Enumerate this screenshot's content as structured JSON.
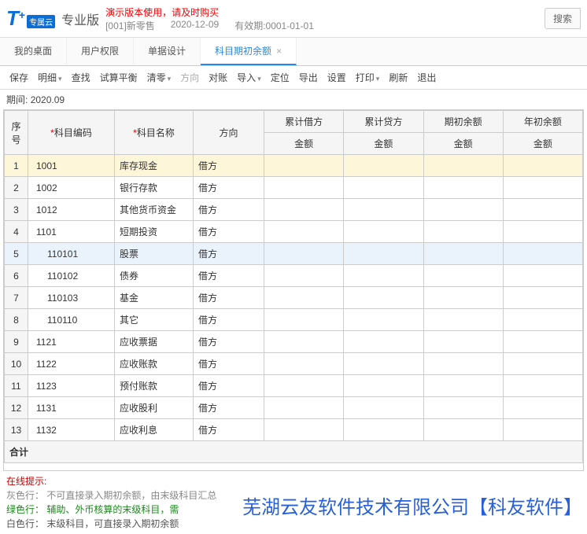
{
  "header": {
    "logo_t": "T",
    "logo_plus": "+",
    "logo_sub": "专属云",
    "edition": "专业版",
    "demo_notice": "演示版本使用，请及时购买",
    "org": "[001]新零售",
    "date": "2020-12-09",
    "expiry_label": "有效期:0001-01-01",
    "search": "搜索"
  },
  "tabs": [
    {
      "label": "我的桌面"
    },
    {
      "label": "用户权限"
    },
    {
      "label": "单据设计"
    },
    {
      "label": "科目期初余额",
      "active": true
    }
  ],
  "toolbar": {
    "save": "保存",
    "detail": "明细",
    "search": "查找",
    "balance": "试算平衡",
    "clear": "清零",
    "direction": "方向",
    "reconcile": "对账",
    "import": "导入",
    "locate": "定位",
    "export": "导出",
    "settings": "设置",
    "print": "打印",
    "refresh": "刷新",
    "exit": "退出"
  },
  "period": {
    "label": "期间:",
    "value": "2020.09"
  },
  "columns": {
    "idx": "序号",
    "code": "科目编码",
    "name": "科目名称",
    "dir": "方向",
    "cum_debit": "累计借方",
    "cum_credit": "累计贷方",
    "opening": "期初余额",
    "year_open": "年初余额",
    "amount": "金额"
  },
  "rows": [
    {
      "n": "1",
      "code": "1001",
      "name": "库存现金",
      "dir": "借方",
      "sel": true
    },
    {
      "n": "2",
      "code": "1002",
      "name": "银行存款",
      "dir": "借方"
    },
    {
      "n": "3",
      "code": "1012",
      "name": "其他货币资金",
      "dir": "借方"
    },
    {
      "n": "4",
      "code": "1101",
      "name": "短期投资",
      "dir": "借方"
    },
    {
      "n": "5",
      "code": "110101",
      "name": "股票",
      "dir": "借方",
      "indent": true,
      "hi": true
    },
    {
      "n": "6",
      "code": "110102",
      "name": "债券",
      "dir": "借方",
      "indent": true
    },
    {
      "n": "7",
      "code": "110103",
      "name": "基金",
      "dir": "借方",
      "indent": true
    },
    {
      "n": "8",
      "code": "110110",
      "name": "其它",
      "dir": "借方",
      "indent": true
    },
    {
      "n": "9",
      "code": "1121",
      "name": "应收票据",
      "dir": "借方"
    },
    {
      "n": "10",
      "code": "1122",
      "name": "应收账款",
      "dir": "借方"
    },
    {
      "n": "11",
      "code": "1123",
      "name": "预付账款",
      "dir": "借方"
    },
    {
      "n": "12",
      "code": "1131",
      "name": "应收股利",
      "dir": "借方"
    },
    {
      "n": "13",
      "code": "1132",
      "name": "应收利息",
      "dir": "借方"
    }
  ],
  "total_label": "合计",
  "hints": {
    "title": "在线提示:",
    "gray": "灰色行： 不可直接录入期初余额，由末级科目汇总",
    "green": "绿色行： 辅助、外币核算的末级科目，需",
    "white": "白色行： 末级科目，可直接录入期初余额"
  },
  "watermark": "芜湖云友软件技术有限公司【科友软件】"
}
